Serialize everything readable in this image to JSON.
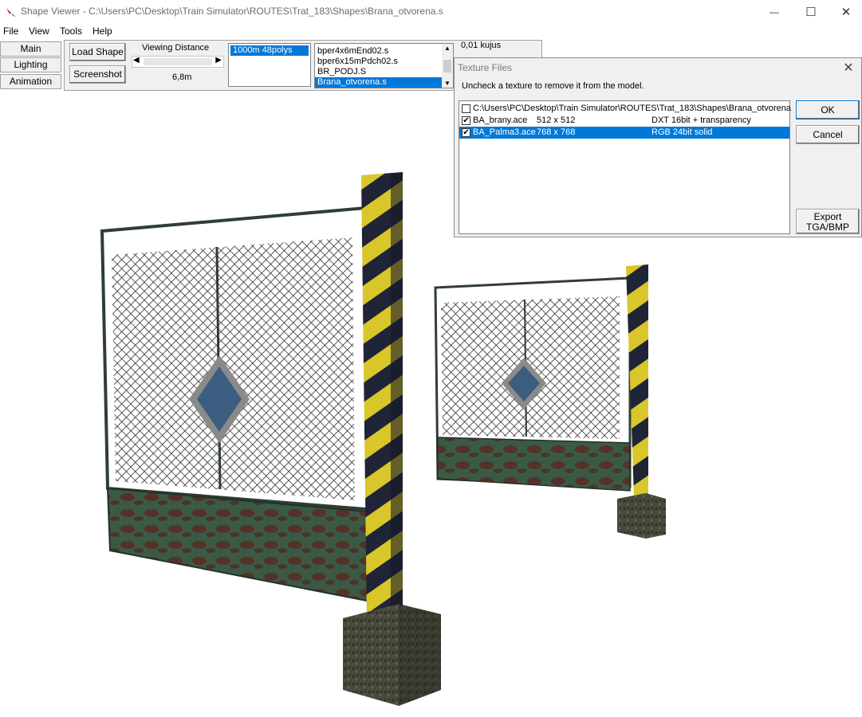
{
  "window": {
    "title": "Shape Viewer - C:\\Users\\PC\\Desktop\\Train Simulator\\ROUTES\\Trat_183\\Shapes\\Brana_otvorena.s",
    "controls": {
      "minimize": "—",
      "maximize": "☐",
      "close": "✕"
    }
  },
  "menu": {
    "file": "File",
    "view": "View",
    "tools": "Tools",
    "help": "Help"
  },
  "sidebar": {
    "main": "Main",
    "lighting": "Lighting",
    "animation": "Animation"
  },
  "toolbar": {
    "load_shape": "Load Shape",
    "screenshot": "Screenshot",
    "viewing_distance_label": "Viewing Distance",
    "viewing_distance_value": "6,8m",
    "lod_items": [
      "1000m 48polys"
    ],
    "shape_files": [
      "bper4x6mEnd02.s",
      "bper6x15mPdch02.s",
      "BR_PODJ.S",
      "Brana_otvorena.s"
    ],
    "status": "0,01 kujus"
  },
  "dialog": {
    "title": "Texture Files",
    "instruction": "Uncheck a texture to remove it from the model.",
    "rows": [
      {
        "checked": false,
        "name": "C:\\Users\\PC\\Desktop\\Train Simulator\\ROUTES\\Trat_183\\Shapes\\Brana_otvorena",
        "size": "",
        "format": ""
      },
      {
        "checked": true,
        "name": "BA_brany.ace",
        "size": "512 x 512",
        "format": "DXT 16bit + transparency"
      },
      {
        "checked": true,
        "name": "BA_Palma3.ace",
        "size": "768 x 768",
        "format": "RGB 24bit solid"
      }
    ],
    "ok": "OK",
    "cancel": "Cancel",
    "export_line1": "Export",
    "export_line2": "TGA/BMP"
  },
  "colors": {
    "selection": "#0078d7",
    "panel": "#f0f0f0",
    "post_yellow": "#d9c62a",
    "post_black": "#1f2436",
    "fence_frame": "#3f5a48",
    "diamond_blue": "#3b5e80"
  }
}
